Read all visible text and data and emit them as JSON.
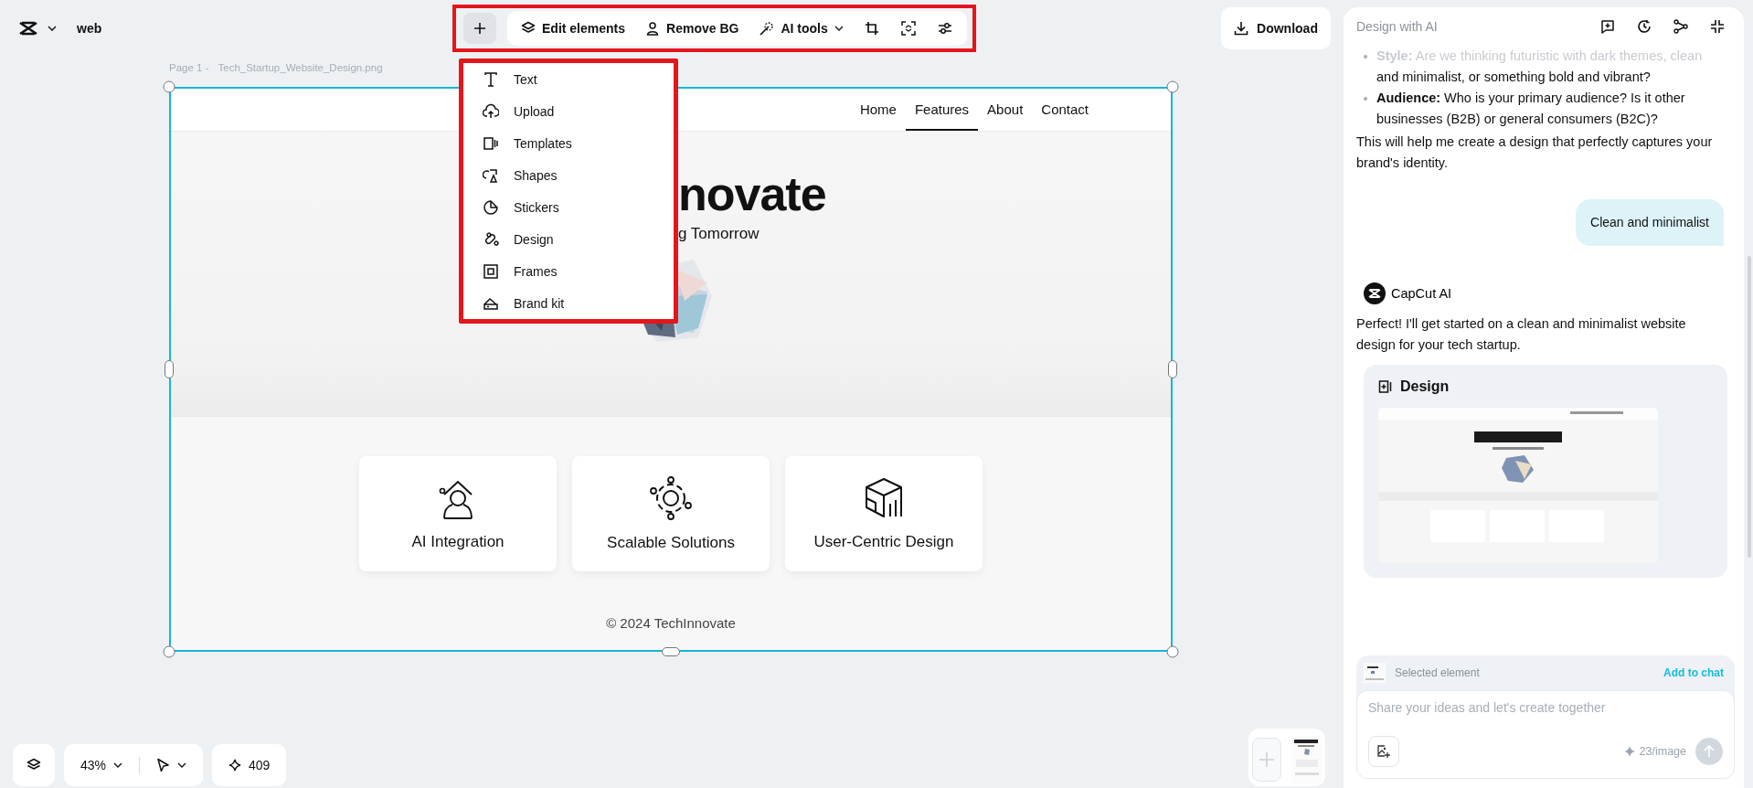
{
  "header": {
    "project_name": "web"
  },
  "toolbar": {
    "highlighted": true,
    "items": [
      {
        "label": "Edit elements",
        "dropdown": false
      },
      {
        "label": "Remove BG",
        "dropdown": false
      },
      {
        "label": "AI tools",
        "dropdown": true
      }
    ]
  },
  "add_menu": {
    "open": true,
    "highlighted": true,
    "items": [
      {
        "label": "Text"
      },
      {
        "label": "Upload"
      },
      {
        "label": "Templates"
      },
      {
        "label": "Shapes"
      },
      {
        "label": "Stickers"
      },
      {
        "label": "Design"
      },
      {
        "label": "Frames"
      },
      {
        "label": "Brand kit"
      }
    ]
  },
  "download_button": "Download",
  "canvas": {
    "page_label": "Page 1 -",
    "file_name": "Tech_Startup_Website_Design.png",
    "selected": true,
    "design": {
      "nav": [
        {
          "label": "Home",
          "selected": false
        },
        {
          "label": "Features",
          "selected": true
        },
        {
          "label": "About",
          "selected": false
        },
        {
          "label": "Contact",
          "selected": false
        }
      ],
      "title": "novate",
      "subtitle": "g Tomorrow",
      "features": [
        {
          "label": "AI Integration"
        },
        {
          "label": "Scalable Solutions"
        },
        {
          "label": "User-Centric Design"
        }
      ],
      "footer": "© 2024 TechInnovate"
    }
  },
  "bottom_bar": {
    "zoom": "43%",
    "credits": "409"
  },
  "chat": {
    "title": "Design with AI",
    "items": [
      {
        "kind": "bullet",
        "faded": true,
        "text": "**Style:** Are we thinking futuristic with dark themes, clean"
      },
      {
        "kind": "continuation",
        "faded": false,
        "text": "and minimalist, or something bold and vibrant?"
      },
      {
        "kind": "bullet",
        "faded": false,
        "text": "**Audience:** Who is your primary audience? Is it other businesses (B2B) or general consumers (B2C)?"
      },
      {
        "kind": "paragraph",
        "faded": false,
        "text": "This will help me create a design that perfectly captures your brand's identity."
      },
      {
        "kind": "user",
        "text": "Clean and minimalist"
      },
      {
        "kind": "sender",
        "text": "CapCut AI"
      },
      {
        "kind": "paragraph",
        "faded": false,
        "text": "Perfect! I'll get started on a clean and minimalist website design for your tech startup."
      },
      {
        "kind": "design_card",
        "title": "Design"
      }
    ],
    "composer": {
      "selected_label": "Selected element",
      "add_label": "Add to chat",
      "placeholder": "Share your ideas and let's create together",
      "cost": "23/image"
    }
  }
}
